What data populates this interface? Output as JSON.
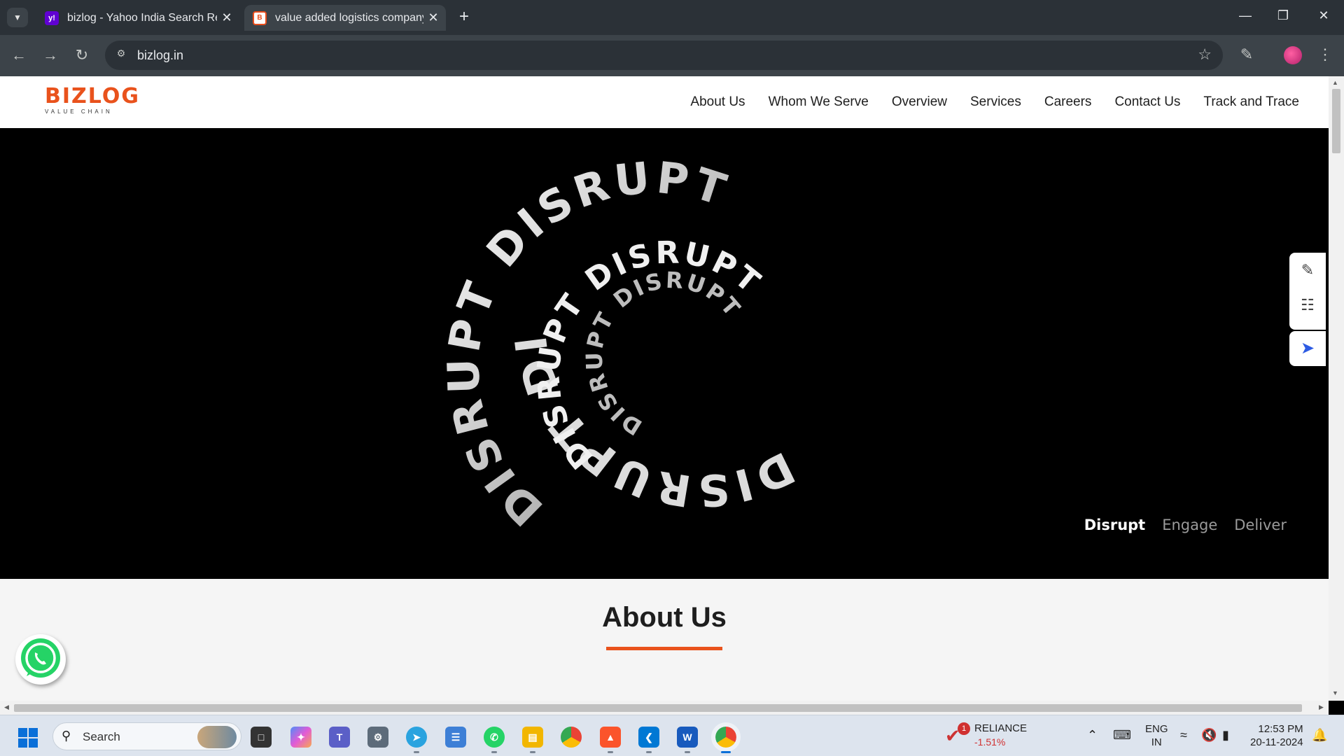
{
  "browser": {
    "tabs": [
      {
        "title": "bizlog - Yahoo India Search Res",
        "favicon": "yahoo-icon"
      },
      {
        "title": "value added logistics company",
        "favicon": "bizlog-icon"
      }
    ],
    "url": "bizlog.in"
  },
  "site": {
    "logo_text": "BIZLOG",
    "logo_tagline": "VALUE CHAIN",
    "nav": [
      "About Us",
      "Whom We Serve",
      "Overview",
      "Services",
      "Careers",
      "Contact Us",
      "Track and Trace"
    ],
    "hero": {
      "spiral_word": "DISRUPT",
      "words": [
        "Disrupt",
        "Engage",
        "Deliver"
      ],
      "active_word": "Disrupt"
    },
    "about_title": "About Us",
    "accent_color": "#e9521c"
  },
  "taskbar": {
    "search_label": "Search",
    "stock": {
      "name": "RELIANCE",
      "change": "-1.51%",
      "badge": "1"
    },
    "language": {
      "line1": "ENG",
      "line2": "IN"
    },
    "time": "12:53 PM",
    "date": "20-11-2024"
  }
}
